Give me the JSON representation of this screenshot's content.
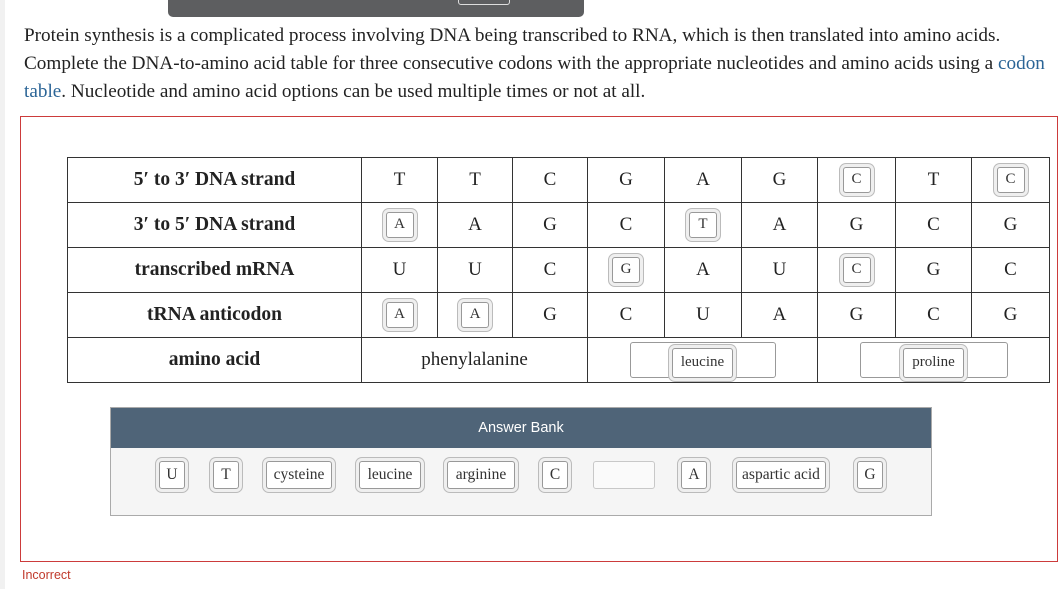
{
  "prompt": {
    "text_before": "Protein synthesis is a complicated process involving DNA being transcribed to RNA, which is then translated into amino acids. Complete the DNA-to-amino acid table for three consecutive codons with the appropriate nucleotides and amino acids using a ",
    "link": "codon table",
    "text_after": ". Nucleotide and amino acid options can be used multiple times or not at all."
  },
  "table": {
    "rows": [
      {
        "label": "5′ to 3′ DNA strand",
        "cells": [
          "T",
          "T",
          "C",
          "G",
          "A",
          "G",
          "C",
          "T",
          "C"
        ]
      },
      {
        "label": "3′ to 5′ DNA strand",
        "cells": [
          "A",
          "A",
          "G",
          "C",
          "T",
          "A",
          "G",
          "C",
          "G"
        ]
      },
      {
        "label": "transcribed mRNA",
        "cells": [
          "U",
          "U",
          "C",
          "G",
          "A",
          "U",
          "C",
          "G",
          "C"
        ]
      },
      {
        "label": "tRNA anticodon",
        "cells": [
          "A",
          "A",
          "G",
          "C",
          "U",
          "A",
          "G",
          "C",
          "G"
        ]
      }
    ],
    "amino": {
      "label": "amino acid",
      "codons": [
        "phenylalanine",
        "leucine",
        "proline"
      ]
    }
  },
  "bank": {
    "title": "Answer Bank",
    "items": [
      "U",
      "T",
      "cysteine",
      "leucine",
      "arginine",
      "C",
      "",
      "A",
      "aspartic acid",
      "G"
    ]
  },
  "status": "Incorrect"
}
